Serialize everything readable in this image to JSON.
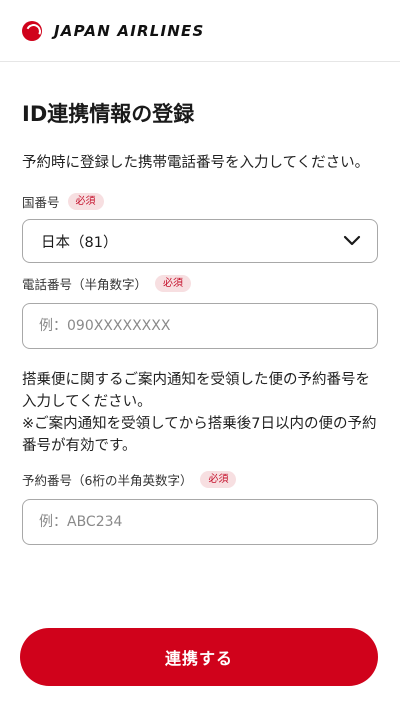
{
  "header": {
    "logo_text": "JAPAN AIRLINES",
    "brand_color": "#d0021b"
  },
  "main": {
    "title": "ID連携情報の登録",
    "intro": "予約時に登録した携帯電話番号を入力してください。",
    "country_field": {
      "label": "国番号",
      "badge": "必須",
      "selected_value": "日本（81）"
    },
    "phone_field": {
      "label": "電話番号（半角数字）",
      "badge": "必須",
      "placeholder": "例：090XXXXXXXX"
    },
    "notes": [
      "搭乗便に関するご案内通知を受領した便の予約番号を入力してください。",
      "※ご案内通知を受領してから搭乗後7日以内の便の予約番号が有効です。"
    ],
    "booking_field": {
      "label": "予約番号（6桁の半角英数字）",
      "badge": "必須",
      "placeholder": "例：ABC234"
    },
    "submit_label": "連携する"
  }
}
